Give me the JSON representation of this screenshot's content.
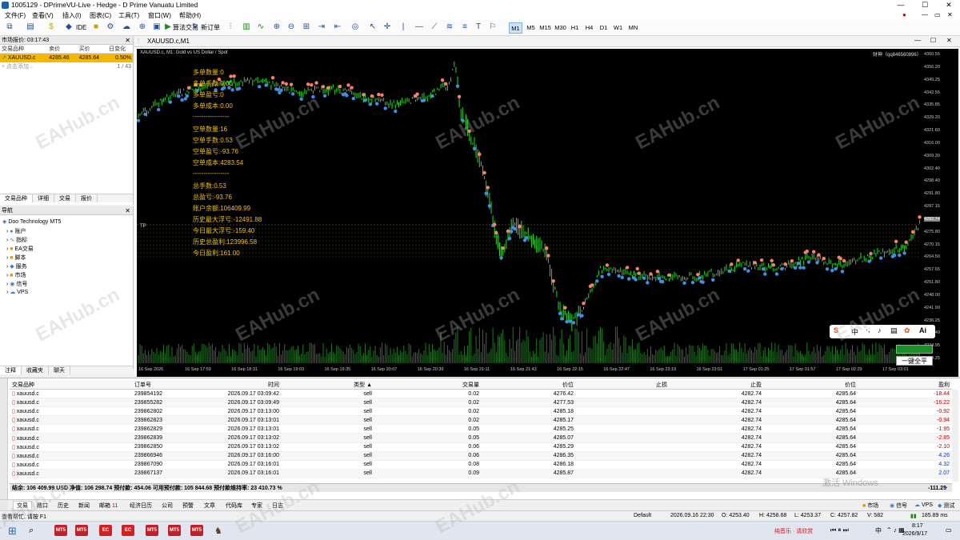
{
  "window": {
    "title": "1005129 - DPrimeVU-Live - Hedge - D Prime Vanuatu Limited",
    "controls": [
      "—",
      "☐",
      "✕"
    ]
  },
  "menu": [
    "文件(F)",
    "查看(V)",
    "插入(I)",
    "图表(C)",
    "工具(T)",
    "窗口(W)",
    "帮助(H)"
  ],
  "toolbar": {
    "ide_label": "IDE",
    "algo_label": "算法交易",
    "new_order_label": "新订单",
    "timeframes": [
      "M1",
      "M5",
      "M15",
      "M30",
      "H1",
      "H4",
      "D1",
      "W1",
      "MN"
    ],
    "active_timeframe": "M1"
  },
  "market_watch": {
    "title": "市场报价: 03:17:43",
    "columns": [
      "交易品种",
      "卖价",
      "买价",
      "日变化"
    ],
    "rows": [
      {
        "symbol": "XAUUSD.c",
        "bid": "4285.46",
        "ask": "4285.64",
        "change": "0.50%"
      }
    ],
    "add_label": "点击添加...",
    "count": "1 / 43",
    "tabs": [
      "交易品种",
      "详细",
      "交易",
      "报价"
    ]
  },
  "navigator": {
    "title": "导航",
    "root": "Doo Technology MT5",
    "items": [
      "账户",
      "指标",
      "EA交易",
      "脚本",
      "服务",
      "市场",
      "信号",
      "VPS"
    ],
    "tabs": [
      "注释",
      "收藏夹",
      "聊天"
    ]
  },
  "chart": {
    "tab_label": "XAUUSD.c,M1",
    "header": "XAUUSD.c, M1:  Gold vs US Dollar / Spot",
    "account_tag": "财神（qq846560896）",
    "overlay": {
      "long_qty": "多单数量:0",
      "long_lots": "多单手数:0.00",
      "long_pl": "多单盈亏:0",
      "long_cost": "多单成本:0.00",
      "sep1": "-----------------",
      "short_qty": "空单数量:16",
      "short_lots": "空单手数:0.53",
      "short_pl": "空单盈亏:-93.76",
      "short_cost": "空单成本:4283.54",
      "sep2": "-----------------",
      "total_lots": "总手数:0.53",
      "total_pl": "总盈亏:-93.76",
      "balance": "账户余额:106409.99",
      "max_float": "历史最大浮亏:-12491.88",
      "today_float": "今日最大浮亏:-159.40",
      "total_profit": "历史总盈利:123996.58",
      "today_profit": "今日盈利:161.00"
    },
    "tp_label": "TP",
    "price_labels": [
      "4360.55",
      "4356.20",
      "4349.25",
      "4342.55",
      "4335.85",
      "4329.20",
      "4321.60",
      "4316.00",
      "4309.30",
      "4302.40",
      "4298.40",
      "4291.80",
      "4287.15",
      "4282.74",
      "4275.80",
      "4270.15",
      "4264.50",
      "4257.65",
      "4251.80",
      "4248.00",
      "4241.90",
      "4236.25",
      "4230.40",
      "4224.95",
      "4219.25"
    ],
    "time_labels": [
      "16 Sep 2026",
      "16 Sep 17:59",
      "16 Sep 18:31",
      "16 Sep 19:03",
      "16 Sep 19:35",
      "16 Sep 20:07",
      "16 Sep 20:39",
      "16 Sep 21:11",
      "16 Sep 21:43",
      "16 Sep 22:15",
      "16 Sep 22:47",
      "16 Sep 23:19",
      "16 Sep 23:51",
      "17 Sep 01:25",
      "17 Sep 01:57",
      "17 Sep 02:29",
      "17 Sep 03:01"
    ],
    "close_all_label": "一键全平",
    "ime_label": "中"
  },
  "trade": {
    "columns": [
      "交易品种",
      "订单号",
      "时间",
      "类型",
      "交易量",
      "价位",
      "止损",
      "止盈",
      "价位",
      "盈利"
    ],
    "rows": [
      {
        "symbol": "xauusd.c",
        "ticket": "239854192",
        "time": "2026.09.17 03:09:42",
        "type": "sell",
        "volume": "0.02",
        "price": "4276.42",
        "sl": "",
        "tp": "4282.74",
        "cur": "4285.64",
        "profit": "-18.44"
      },
      {
        "symbol": "xauusd.c",
        "ticket": "239855282",
        "time": "2026.09.17 03:09:49",
        "type": "sell",
        "volume": "0.02",
        "price": "4277.53",
        "sl": "",
        "tp": "4282.74",
        "cur": "4285.64",
        "profit": "-16.22"
      },
      {
        "symbol": "xauusd.c",
        "ticket": "239862802",
        "time": "2026.09.17 03:13:00",
        "type": "sell",
        "volume": "0.02",
        "price": "4285.18",
        "sl": "",
        "tp": "4282.74",
        "cur": "4285.64",
        "profit": "-0.92"
      },
      {
        "symbol": "xauusd.c",
        "ticket": "239862823",
        "time": "2026.09.17 03:13:01",
        "type": "sell",
        "volume": "0.02",
        "price": "4285.17",
        "sl": "",
        "tp": "4282.74",
        "cur": "4285.64",
        "profit": "-0.94"
      },
      {
        "symbol": "xauusd.c",
        "ticket": "239862829",
        "time": "2026.09.17 03:13:01",
        "type": "sell",
        "volume": "0.05",
        "price": "4285.25",
        "sl": "",
        "tp": "4282.74",
        "cur": "4285.64",
        "profit": "-1.95"
      },
      {
        "symbol": "xauusd.c",
        "ticket": "239862839",
        "time": "2026.09.17 03:13:02",
        "type": "sell",
        "volume": "0.05",
        "price": "4285.07",
        "sl": "",
        "tp": "4282.74",
        "cur": "4285.64",
        "profit": "-2.85"
      },
      {
        "symbol": "xauusd.c",
        "ticket": "239862850",
        "time": "2026.09.17 03:13:02",
        "type": "sell",
        "volume": "0.06",
        "price": "4285.29",
        "sl": "",
        "tp": "4282.74",
        "cur": "4285.64",
        "profit": "-2.10"
      },
      {
        "symbol": "xauusd.c",
        "ticket": "239866946",
        "time": "2026.09.17 03:16:00",
        "type": "sell",
        "volume": "0.06",
        "price": "4286.35",
        "sl": "",
        "tp": "4282.74",
        "cur": "4285.64",
        "profit": "4.26"
      },
      {
        "symbol": "xauusd.c",
        "ticket": "239867090",
        "time": "2026.09.17 03:16:01",
        "type": "sell",
        "volume": "0.08",
        "price": "4286.18",
        "sl": "",
        "tp": "4282.74",
        "cur": "4285.64",
        "profit": "4.32"
      },
      {
        "symbol": "xauusd.c",
        "ticket": "239867137",
        "time": "2026.09.17 03:16:01",
        "type": "sell",
        "volume": "0.09",
        "price": "4285.87",
        "sl": "",
        "tp": "4282.74",
        "cur": "4285.64",
        "profit": "2.07"
      }
    ],
    "summary": "结余: 106 409.99 USD  净值: 106 298.74  预付款: 454.06  可用预付款: 105 844.68  预付款维持率: 23 410.73 %",
    "summary_total": "-111.25"
  },
  "bottom_tabs": [
    "交易",
    "敞口",
    "历史",
    "新闻",
    "邮箱",
    "经济日历",
    "公司",
    "预警",
    "文章",
    "代码库",
    "专家",
    "日志"
  ],
  "mail_badge": "11",
  "right_tabs": [
    "市场",
    "信号",
    "VPS",
    "测试"
  ],
  "status": {
    "help": "查看帮忙, 请按 F1",
    "profile": "Default",
    "datetime": "2026.09.16 22:30",
    "open": "O: 4253.40",
    "high": "H: 4258.68",
    "low": "L: 4253.37",
    "close": "C: 4257.82",
    "volume": "V: 582",
    "ping": "185.89 ms"
  },
  "taskbar": {
    "time": "8:17",
    "date": "2026/9/17",
    "music": "纯音乐 · 请欣赏",
    "apps": [
      "MT5",
      "MT5",
      "EC",
      "EC",
      "MT5",
      "MT5",
      "MT5"
    ]
  },
  "watermark": "EAHub.cn",
  "activate_windows": "激活 Windows"
}
